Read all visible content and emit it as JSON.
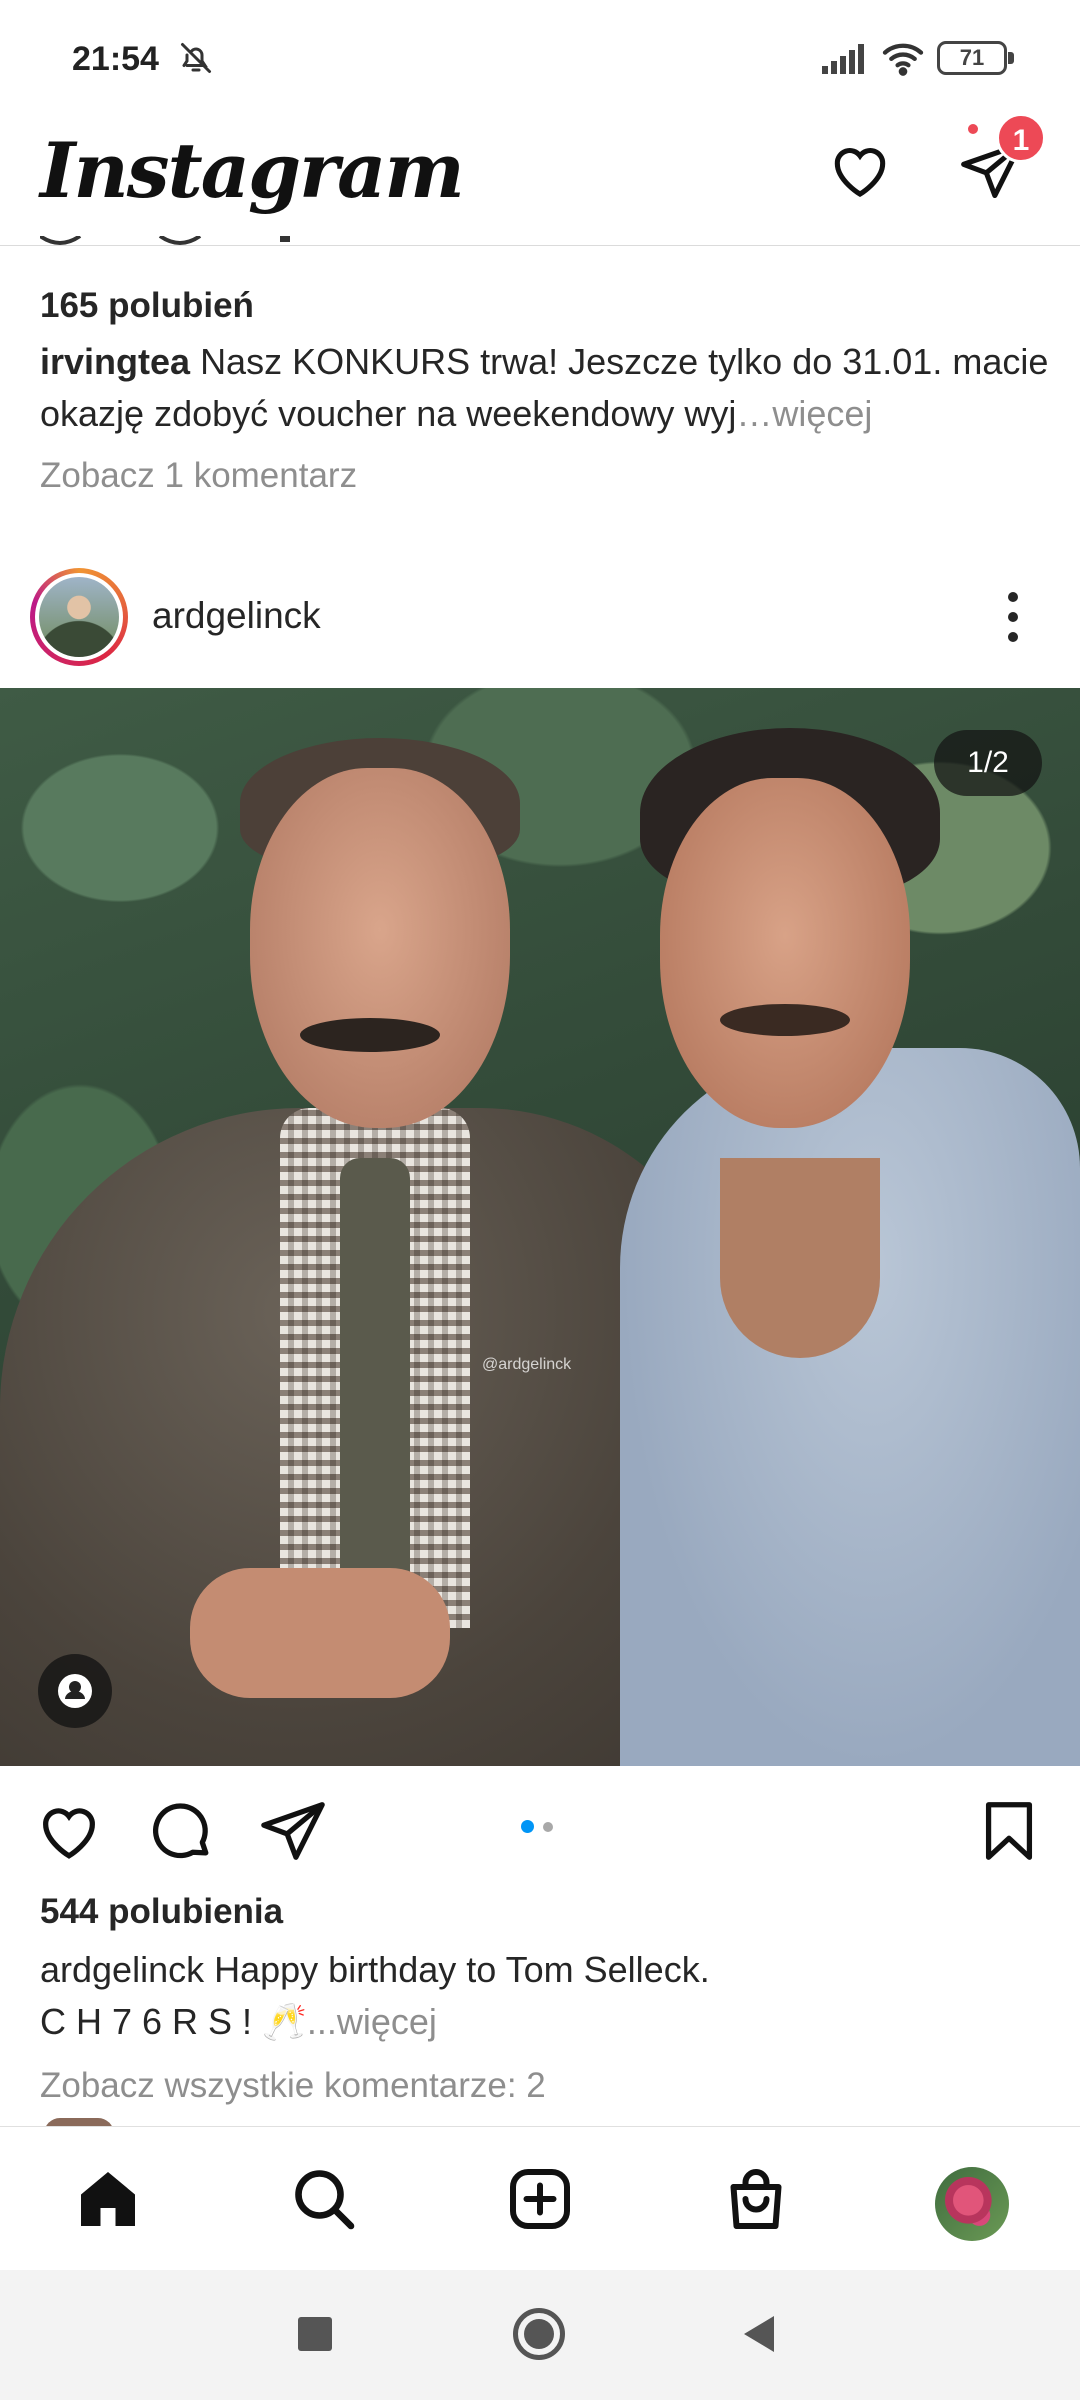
{
  "status_bar": {
    "time": "21:54",
    "battery": "71",
    "icons": [
      "bell-off-icon",
      "signal-icon",
      "wifi-icon",
      "battery-icon"
    ]
  },
  "header": {
    "logo": "Instagram",
    "notification_badge": "1"
  },
  "previous_post": {
    "likes": "165 polubień",
    "caption_user": "irvingtea",
    "caption_text": "Nasz KONKURS trwa! Jeszcze tylko do 31.01. macie okazję zdobyć voucher na weekendowy wyj",
    "caption_more": "…więcej",
    "comments_link": "Zobacz 1 komentarz"
  },
  "post": {
    "username": "ardgelinck",
    "media_counter": "1/2",
    "watermark": "@ardgelinck",
    "likes": "544 polubienia",
    "caption_user": "ardgelinck",
    "caption_line1": "Happy  birthday to Tom Selleck.",
    "caption_line2": "C H 7 6 R S ! 🥂",
    "caption_more": "...więcej",
    "comments_link": "Zobacz wszystkie komentarze: 2",
    "carousel_active_index": 1,
    "carousel_count": 2
  },
  "colors": {
    "accent_blue": "#0095f6",
    "badge_red": "#ed4956",
    "muted_text": "#8e8e8e"
  }
}
